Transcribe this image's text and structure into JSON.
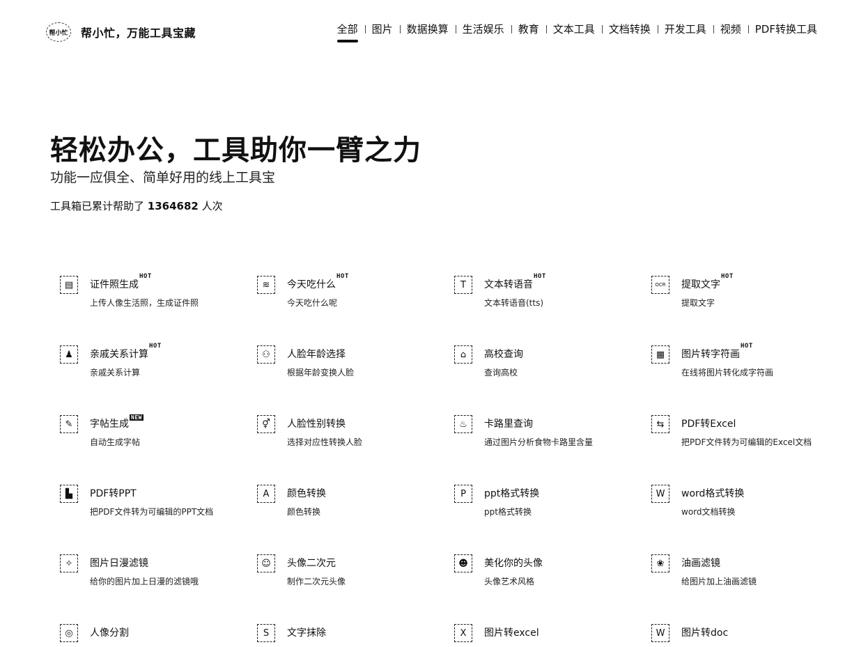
{
  "brand": {
    "logo_text": "帮小忙",
    "title": "帮小忙，万能工具宝藏"
  },
  "nav": [
    "全部",
    "图片",
    "数据换算",
    "生活娱乐",
    "教育",
    "文本工具",
    "文档转换",
    "开发工具",
    "视频",
    "PDF转换工具"
  ],
  "hero": {
    "title": "轻松办公，工具助你一臂之力",
    "subtitle": "功能一应俱全、简单好用的线上工具宝",
    "count_prefix": "工具箱已累计帮助了",
    "count_value": "1364682",
    "count_suffix": "人次"
  },
  "tools": [
    {
      "name": "证件照生成",
      "badge": "HOT",
      "desc": "上传人像生活照，生成证件照",
      "icon": "id-card-icon",
      "glyph": "▤"
    },
    {
      "name": "今天吃什么",
      "badge": "HOT",
      "desc": "今天吃什么呢",
      "icon": "food-icon",
      "glyph": "≋"
    },
    {
      "name": "文本转语音",
      "badge": "HOT",
      "desc": "文本转语音(tts)",
      "icon": "text-to-speech-icon",
      "glyph": "T"
    },
    {
      "name": "提取文字",
      "badge": "HOT",
      "desc": "提取文字",
      "icon": "ocr-icon",
      "glyph": "OCR"
    },
    {
      "name": "亲戚关系计算",
      "badge": "HOT",
      "desc": "亲戚关系计算",
      "icon": "family-icon",
      "glyph": "♟"
    },
    {
      "name": "人脸年龄选择",
      "badge": "",
      "desc": "根据年龄变换人脸",
      "icon": "face-age-icon",
      "glyph": "⚇"
    },
    {
      "name": "高校查询",
      "badge": "",
      "desc": "查询高校",
      "icon": "university-icon",
      "glyph": "⌂"
    },
    {
      "name": "图片转字符画",
      "badge": "HOT",
      "desc": "在线将图片转化成字符画",
      "icon": "ascii-art-icon",
      "glyph": "▦"
    },
    {
      "name": "字帖生成",
      "badge": "NEW",
      "desc": "自动生成字帖",
      "icon": "copybook-icon",
      "glyph": "✎"
    },
    {
      "name": "人脸性别转换",
      "badge": "",
      "desc": "选择对应性转换人脸",
      "icon": "gender-swap-icon",
      "glyph": "⚥"
    },
    {
      "name": "卡路里查询",
      "badge": "",
      "desc": "通过图片分析食物卡路里含量",
      "icon": "calorie-icon",
      "glyph": "♨"
    },
    {
      "name": "PDF转Excel",
      "badge": "",
      "desc": "把PDF文件转为可编辑的Excel文档",
      "icon": "pdf-excel-icon",
      "glyph": "⇆"
    },
    {
      "name": "PDF转PPT",
      "badge": "",
      "desc": "把PDF文件转为可编辑的PPT文档",
      "icon": "pdf-ppt-icon",
      "glyph": "▙"
    },
    {
      "name": "颜色转换",
      "badge": "",
      "desc": "颜色转换",
      "icon": "color-icon",
      "glyph": "A"
    },
    {
      "name": "ppt格式转换",
      "badge": "",
      "desc": "ppt格式转换",
      "icon": "ppt-icon",
      "glyph": "P"
    },
    {
      "name": "word格式转换",
      "badge": "",
      "desc": "word文档转换",
      "icon": "word-icon",
      "glyph": "W"
    },
    {
      "name": "图片日漫滤镜",
      "badge": "",
      "desc": "给你的图片加上日漫的滤镜哦",
      "icon": "anime-filter-icon",
      "glyph": "✧"
    },
    {
      "name": "头像二次元",
      "badge": "",
      "desc": "制作二次元头像",
      "icon": "avatar-anime-icon",
      "glyph": "☺"
    },
    {
      "name": "美化你的头像",
      "badge": "",
      "desc": "头像艺术风格",
      "icon": "avatar-beautify-icon",
      "glyph": "☻"
    },
    {
      "name": "油画滤镜",
      "badge": "",
      "desc": "给图片加上油画滤镜",
      "icon": "oil-painting-icon",
      "glyph": "❀"
    },
    {
      "name": "人像分割",
      "badge": "",
      "desc": "",
      "icon": "portrait-segment-icon",
      "glyph": "◎"
    },
    {
      "name": "文字抹除",
      "badge": "",
      "desc": "",
      "icon": "text-erase-icon",
      "glyph": "S"
    },
    {
      "name": "图片转excel",
      "badge": "",
      "desc": "",
      "icon": "image-excel-icon",
      "glyph": "X"
    },
    {
      "name": "图片转doc",
      "badge": "",
      "desc": "",
      "icon": "image-doc-icon",
      "glyph": "W"
    }
  ]
}
